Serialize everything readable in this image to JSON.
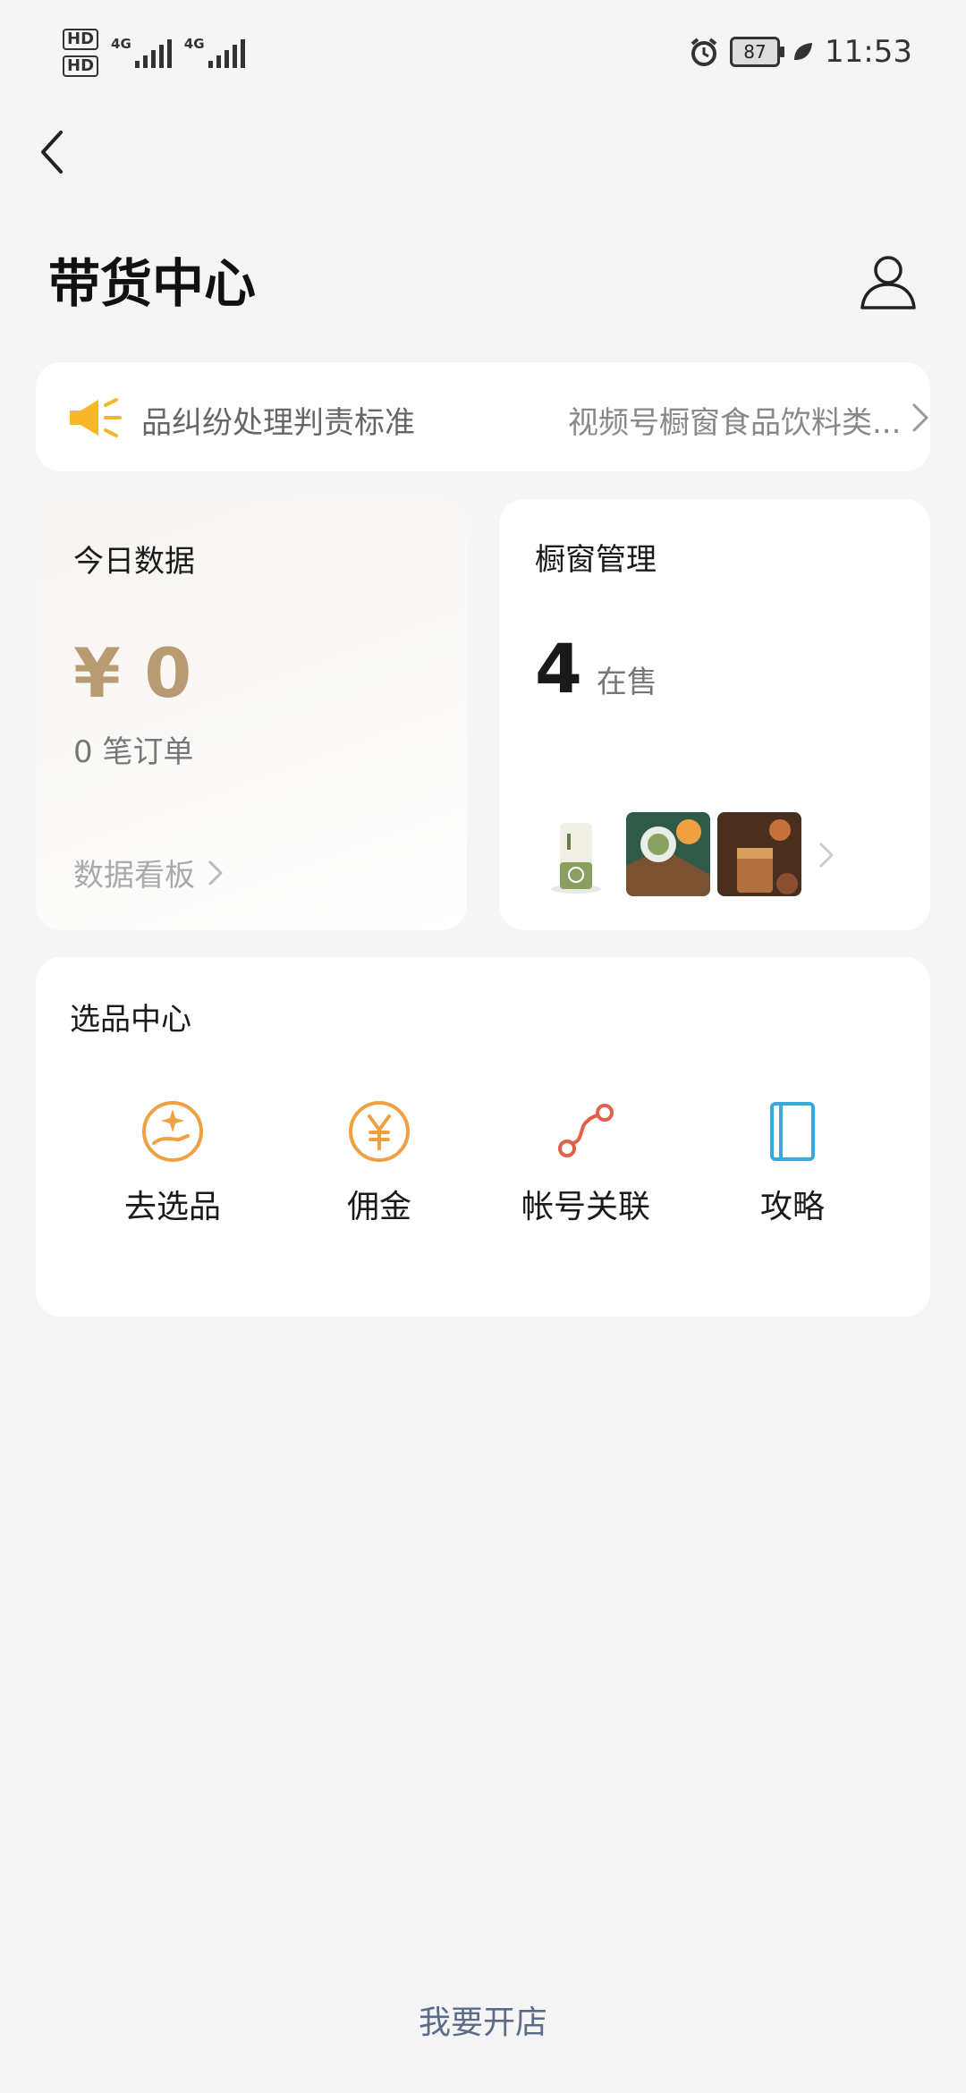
{
  "status_bar": {
    "sim1": "HD",
    "sim2": "HD",
    "net1": "4G",
    "net2": "4G",
    "battery": "87",
    "time": "11:53"
  },
  "header": {
    "title": "带货中心"
  },
  "notice": {
    "text1": "品纠纷处理判责标准",
    "text2": "视频号橱窗食品饮料类..."
  },
  "today": {
    "heading": "今日数据",
    "amount": "¥ 0",
    "orders": "0 笔订单",
    "link": "数据看板"
  },
  "window_mgmt": {
    "heading": "橱窗管理",
    "count": "4",
    "count_label": "在售"
  },
  "selection": {
    "heading": "选品中心",
    "items": [
      {
        "label": "去选品",
        "icon": "select-product-icon"
      },
      {
        "label": "佣金",
        "icon": "yen-coin-icon"
      },
      {
        "label": "帐号关联",
        "icon": "link-icon"
      },
      {
        "label": "攻略",
        "icon": "book-icon"
      }
    ]
  },
  "footer": {
    "open_store": "我要开店"
  },
  "colors": {
    "accent_gold": "#b89b73",
    "orange": "#f0a040",
    "red_link": "#e06048",
    "blue_book": "#3aa8dc",
    "footer_link": "#5b6b88"
  }
}
